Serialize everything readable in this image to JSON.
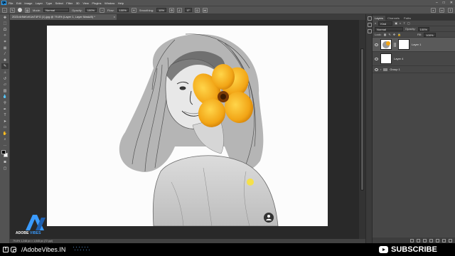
{
  "app": {
    "logo": "Ps",
    "menu": [
      "File",
      "Edit",
      "Image",
      "Layer",
      "Type",
      "Select",
      "Filter",
      "3D",
      "View",
      "Plugins",
      "Window",
      "Help"
    ]
  },
  "options_bar": {
    "mode_label": "Mode:",
    "mode_value": "Normal",
    "opacity_label": "Opacity:",
    "opacity_value": "100%",
    "flow_label": "Flow:",
    "flow_value": "100%",
    "smoothing_label": "Smoothing:",
    "smoothing_value": "10%",
    "angle_value": "0°"
  },
  "document": {
    "tab_title": "2021r4r9dKvKUsT4FG (1).jpg @ 79.8% (Layer 1, Layer Mask/8) *",
    "status": "79.8%   1,248 px × 1,045 px (72 ppi)"
  },
  "panel": {
    "tabs": [
      "Layers",
      "Channels",
      "Paths"
    ],
    "kind_label": "Kind",
    "blend_mode": "Normal",
    "opacity_label": "Opacity:",
    "opacity_value": "100%",
    "lock_label": "Lock:",
    "fill_label": "Fill:",
    "fill_value": "100%",
    "layers": [
      {
        "name": "Layer 1",
        "selected": true
      },
      {
        "name": "Layer 4",
        "selected": false
      }
    ],
    "group_name": "Group 1"
  },
  "watermark": {
    "text_a": "ADOBE ",
    "text_b": "VIBES",
    "brand_color": "#3a9bff"
  },
  "footer": {
    "handle": "/AdobeVibes.IN",
    "subscribe": "SUBSCRIBE"
  },
  "colors": {
    "flower": "#f2a516",
    "workspace": "#292929",
    "accent": "#3a9bff"
  }
}
